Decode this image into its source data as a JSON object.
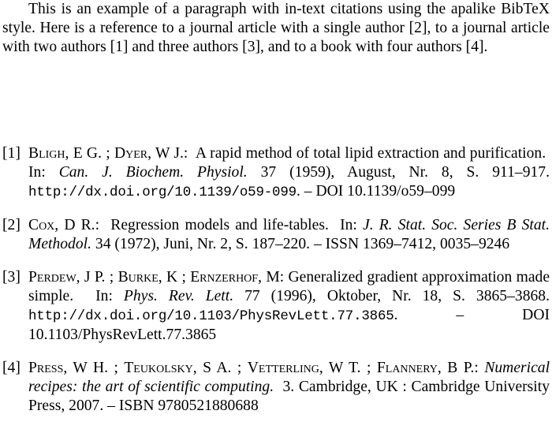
{
  "paragraph": {
    "text": "This is an example of a paragraph with in-text citations using the apalike BibTeX style. Here is a reference to a journal article with a single author [2], to a journal article with two authors [1] and three authors [3], and to a book with four authors [4]."
  },
  "references": [
    {
      "label": "[1]",
      "authors": [
        {
          "last": "Bligh",
          "first": "E G."
        },
        {
          "last": "Dyer",
          "first": "W J."
        }
      ],
      "author_seps": [
        " ; "
      ],
      "author_end": ":",
      "title": "A rapid method of total lipid extraction and purification.",
      "in": "In:",
      "journal": "Can. J. Biochem. Physiol.",
      "details": "37 (1959), August, Nr. 8, S. 911–917.",
      "url": "http://dx.doi.org/10.1139/o59-099",
      "after_url": ". – DOI 10.1139/o59–099"
    },
    {
      "label": "[2]",
      "authors": [
        {
          "last": "Cox",
          "first": "D R."
        }
      ],
      "author_end": ":",
      "title": "Regression models and life-tables.",
      "in": "In:",
      "journal": "J. R. Stat. Soc. Series B Stat. Methodol.",
      "details": "34 (1972), Juni, Nr. 2, S. 187–220. – ISSN 1369–7412, 0035–9246"
    },
    {
      "label": "[3]",
      "authors": [
        {
          "last": "Perdew",
          "first": "J P."
        },
        {
          "last": "Burke",
          "first": "K"
        },
        {
          "last": "Ernzerhof",
          "first": "M"
        }
      ],
      "author_end": ":",
      "title": "Generalized gradient approximation made simple.",
      "in": "In:",
      "journal": "Phys. Rev. Lett.",
      "details": "77 (1996), Oktober, Nr. 18, S. 3865–3868.",
      "url": "http://dx.doi.org/10.1103/PhysRevLett.77.3865",
      "after_url": ". – DOI 10.1103/PhysRevLett.77.3865"
    },
    {
      "label": "[4]",
      "authors": [
        {
          "last": "Press",
          "first": "W H."
        },
        {
          "last": "Teukolsky",
          "first": "S A."
        },
        {
          "last": "Vetterling",
          "first": "W T."
        },
        {
          "last": "Flannery",
          "first": "B P."
        }
      ],
      "author_end": ":",
      "title": "Numerical recipes: the art of scientific computing.",
      "details": "3. Cambridge, UK : Cambridge University Press, 2007. – ISBN 9780521880688"
    }
  ]
}
